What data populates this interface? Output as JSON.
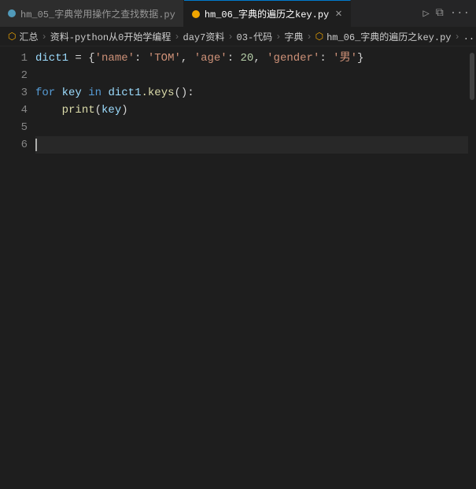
{
  "tabs": [
    {
      "id": "tab1",
      "label": "hm_05_字典常用操作之查找数据.py",
      "active": false,
      "modified": false,
      "icon": "blue"
    },
    {
      "id": "tab2",
      "label": "hm_06_字典的遍历之key.py",
      "active": true,
      "modified": false,
      "icon": "orange"
    }
  ],
  "tab_actions": [
    "▷",
    "⧉",
    "···"
  ],
  "breadcrumb": {
    "parts": [
      "汇总",
      "资料-python从0开始学编程",
      "day7资料",
      "03-代码",
      "字典",
      "hm_06_字典的遍历之key.py",
      "..."
    ]
  },
  "code": {
    "lines": [
      {
        "number": "1",
        "tokens": [
          {
            "text": "dict1",
            "cls": "var"
          },
          {
            "text": " = {",
            "cls": "plain"
          },
          {
            "text": "'name'",
            "cls": "str"
          },
          {
            "text": ": ",
            "cls": "plain"
          },
          {
            "text": "'TOM'",
            "cls": "str"
          },
          {
            "text": ", ",
            "cls": "plain"
          },
          {
            "text": "'age'",
            "cls": "str"
          },
          {
            "text": ": ",
            "cls": "plain"
          },
          {
            "text": "20",
            "cls": "num"
          },
          {
            "text": ", ",
            "cls": "plain"
          },
          {
            "text": "'gender'",
            "cls": "str"
          },
          {
            "text": ": ",
            "cls": "plain"
          },
          {
            "text": "'男'",
            "cls": "str"
          },
          {
            "text": "}",
            "cls": "plain"
          }
        ]
      },
      {
        "number": "2",
        "tokens": []
      },
      {
        "number": "3",
        "tokens": [
          {
            "text": "for",
            "cls": "kw"
          },
          {
            "text": " ",
            "cls": "plain"
          },
          {
            "text": "key",
            "cls": "var"
          },
          {
            "text": " ",
            "cls": "plain"
          },
          {
            "text": "in",
            "cls": "kw"
          },
          {
            "text": " ",
            "cls": "plain"
          },
          {
            "text": "dict1",
            "cls": "var"
          },
          {
            "text": ".keys",
            "cls": "method"
          },
          {
            "text": "():",
            "cls": "plain"
          }
        ]
      },
      {
        "number": "4",
        "tokens": [
          {
            "text": "    ",
            "cls": "plain"
          },
          {
            "text": "print",
            "cls": "fn"
          },
          {
            "text": "(",
            "cls": "plain"
          },
          {
            "text": "key",
            "cls": "var"
          },
          {
            "text": ")",
            "cls": "plain"
          }
        ]
      },
      {
        "number": "5",
        "tokens": []
      },
      {
        "number": "6",
        "tokens": []
      }
    ]
  }
}
